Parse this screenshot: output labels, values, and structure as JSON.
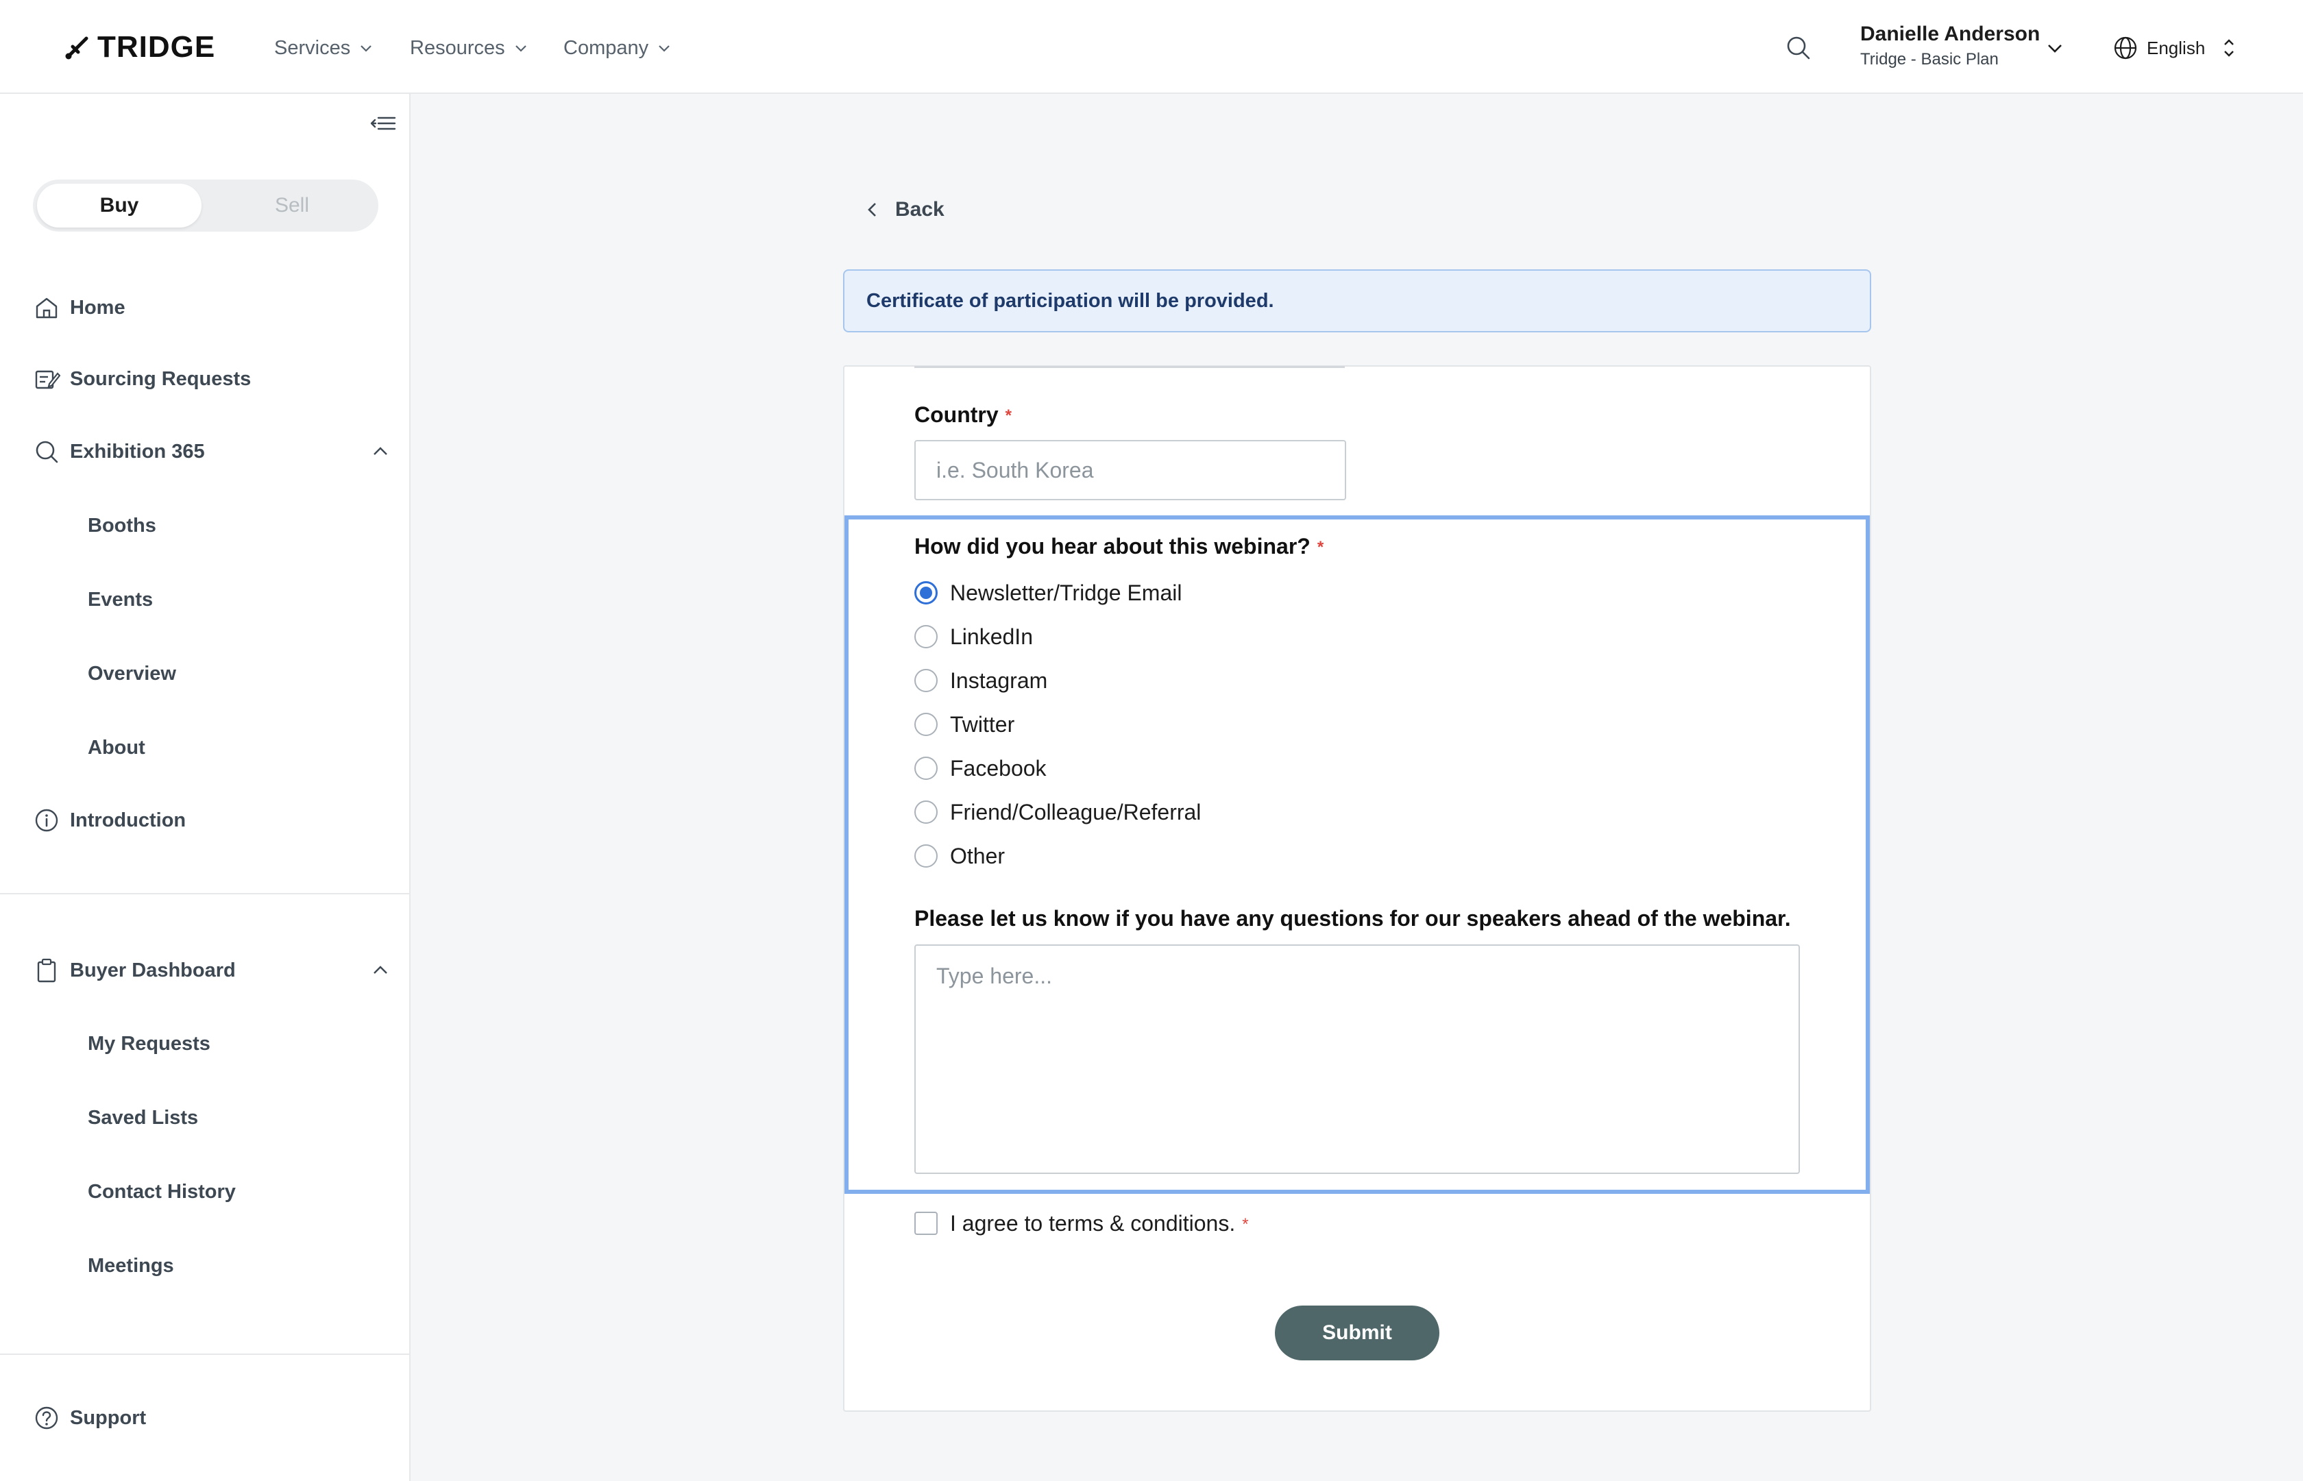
{
  "header": {
    "logo_text": "TRIDGE",
    "nav": [
      {
        "label": "Services"
      },
      {
        "label": "Resources"
      },
      {
        "label": "Company"
      }
    ],
    "user": {
      "name": "Danielle Anderson",
      "plan": "Tridge - Basic Plan"
    },
    "language": "English"
  },
  "sidebar": {
    "toggle": {
      "buy": "Buy",
      "sell": "Sell",
      "active": "Buy"
    },
    "items": [
      {
        "label": "Home",
        "icon": "home-icon"
      },
      {
        "label": "Sourcing Requests",
        "icon": "sourcing-icon"
      },
      {
        "label": "Exhibition 365",
        "icon": "search-icon",
        "expanded": true,
        "children": [
          "Booths",
          "Events",
          "Overview",
          "About"
        ]
      },
      {
        "label": "Introduction",
        "icon": "info-icon"
      }
    ],
    "dashboard": {
      "label": "Buyer Dashboard",
      "icon": "clipboard-icon",
      "expanded": true,
      "children": [
        "My Requests",
        "Saved Lists",
        "Contact History",
        "Meetings"
      ]
    },
    "support": {
      "label": "Support",
      "icon": "help-icon"
    }
  },
  "main": {
    "back_label": "Back",
    "notice": "Certificate of participation will be provided.",
    "form": {
      "country": {
        "label": "Country",
        "required_mark": "*",
        "placeholder": "i.e. South Korea",
        "value": ""
      },
      "hear_about": {
        "label": "How did you hear about this webinar?",
        "required_mark": "*",
        "options": [
          "Newsletter/Tridge Email",
          "LinkedIn",
          "Instagram",
          "Twitter",
          "Facebook",
          "Friend/Colleague/Referral",
          "Other"
        ],
        "selected": "Newsletter/Tridge Email"
      },
      "questions": {
        "label": "Please let us know if you have any questions for our speakers ahead of the webinar.",
        "placeholder": "Type here...",
        "value": ""
      },
      "agree": {
        "label": "I agree to terms & conditions.",
        "required_mark": "*",
        "checked": false
      },
      "submit_label": "Submit"
    }
  },
  "colors": {
    "accent_blue": "#2f6fd8",
    "highlight_border": "#82aeee",
    "notice_bg": "#e8f0fb",
    "submit_bg": "#4f6769",
    "required": "#e0453d"
  }
}
